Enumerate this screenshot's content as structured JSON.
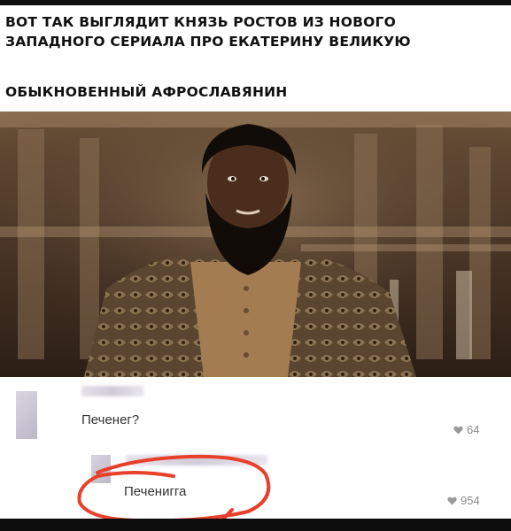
{
  "meme": {
    "caption_line1": "ВОТ ТАК ВЫГЛЯДИТ КНЯЗЬ РОСТОВ ИЗ НОВОГО",
    "caption_line2": "ЗАПАДНОГО СЕРИАЛА ПРО ЕКАТЕРИНУ ВЕЛИКУЮ",
    "caption_line3": "ОБЫКНОВЕННЫЙ АФРОСЛАВЯНИН"
  },
  "comments": [
    {
      "text": "Печенег?",
      "likes": "64"
    },
    {
      "text": "Печенигга",
      "likes": "954"
    }
  ],
  "colors": {
    "highlight_circle": "#e8402a",
    "like_icon": "#9a9a9a"
  },
  "icons": {
    "like": "heart-icon"
  }
}
